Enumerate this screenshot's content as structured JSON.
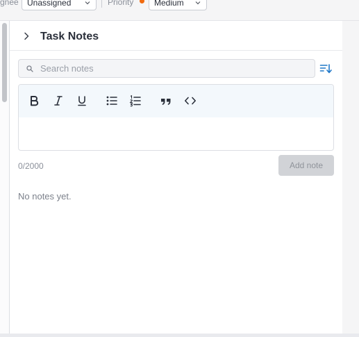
{
  "topbar": {
    "assignee_label_partial": "gnee",
    "assignee_value": "Unassigned",
    "priority_label": "Priority",
    "priority_value": "Medium",
    "priority_dot_color": "#f06a0f"
  },
  "panel": {
    "title": "Task Notes",
    "search": {
      "placeholder": "Search notes",
      "value": ""
    },
    "editor": {
      "tools": [
        "bold-icon",
        "italic-icon",
        "underline-icon",
        "bullet-list-icon",
        "numbered-list-icon",
        "quote-icon",
        "code-icon"
      ],
      "value": ""
    },
    "char_count": "0/2000",
    "add_label": "Add note",
    "empty_text": "No notes yet."
  },
  "colors": {
    "accent": "#1f78c9",
    "toolbar_bg": "#f3f8fc",
    "disabled_button": "#d1d3d7"
  }
}
